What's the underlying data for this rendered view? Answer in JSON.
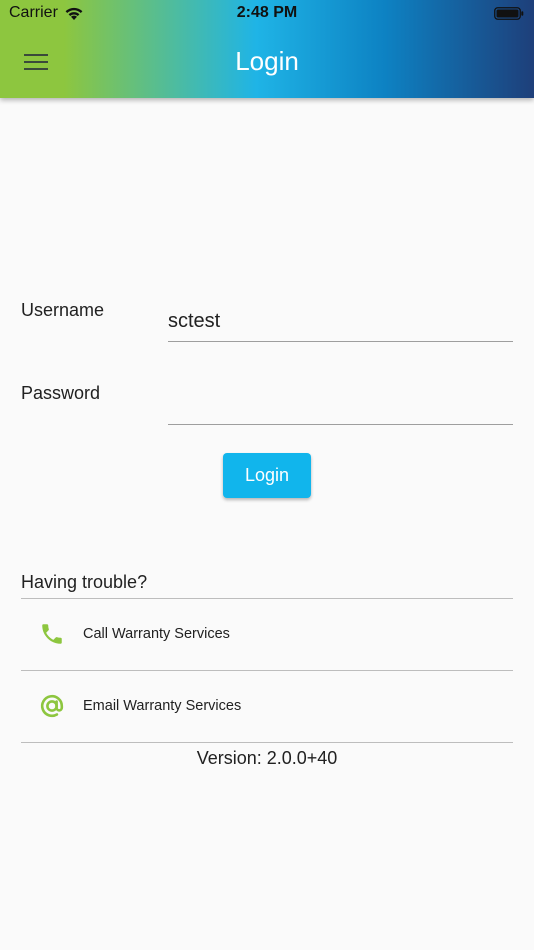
{
  "status_bar": {
    "carrier": "Carrier",
    "time": "2:48 PM"
  },
  "app_bar": {
    "title": "Login",
    "menu_icon": "hamburger-menu-icon",
    "gradient_colors": [
      "#8dc63f",
      "#1fb4e6",
      "#1e3f7a"
    ]
  },
  "form": {
    "username_label": "Username",
    "username_value": "sctest",
    "password_label": "Password",
    "password_value": "",
    "login_button": "Login",
    "button_color": "#11b5ec"
  },
  "help": {
    "heading": "Having trouble?",
    "items": [
      {
        "label": "Call Warranty Services",
        "icon": "phone-icon"
      },
      {
        "label": "Email Warranty Services",
        "icon": "at-sign-icon"
      }
    ],
    "icon_color": "#8dc63f"
  },
  "footer": {
    "version": "Version: 2.0.0+40"
  }
}
